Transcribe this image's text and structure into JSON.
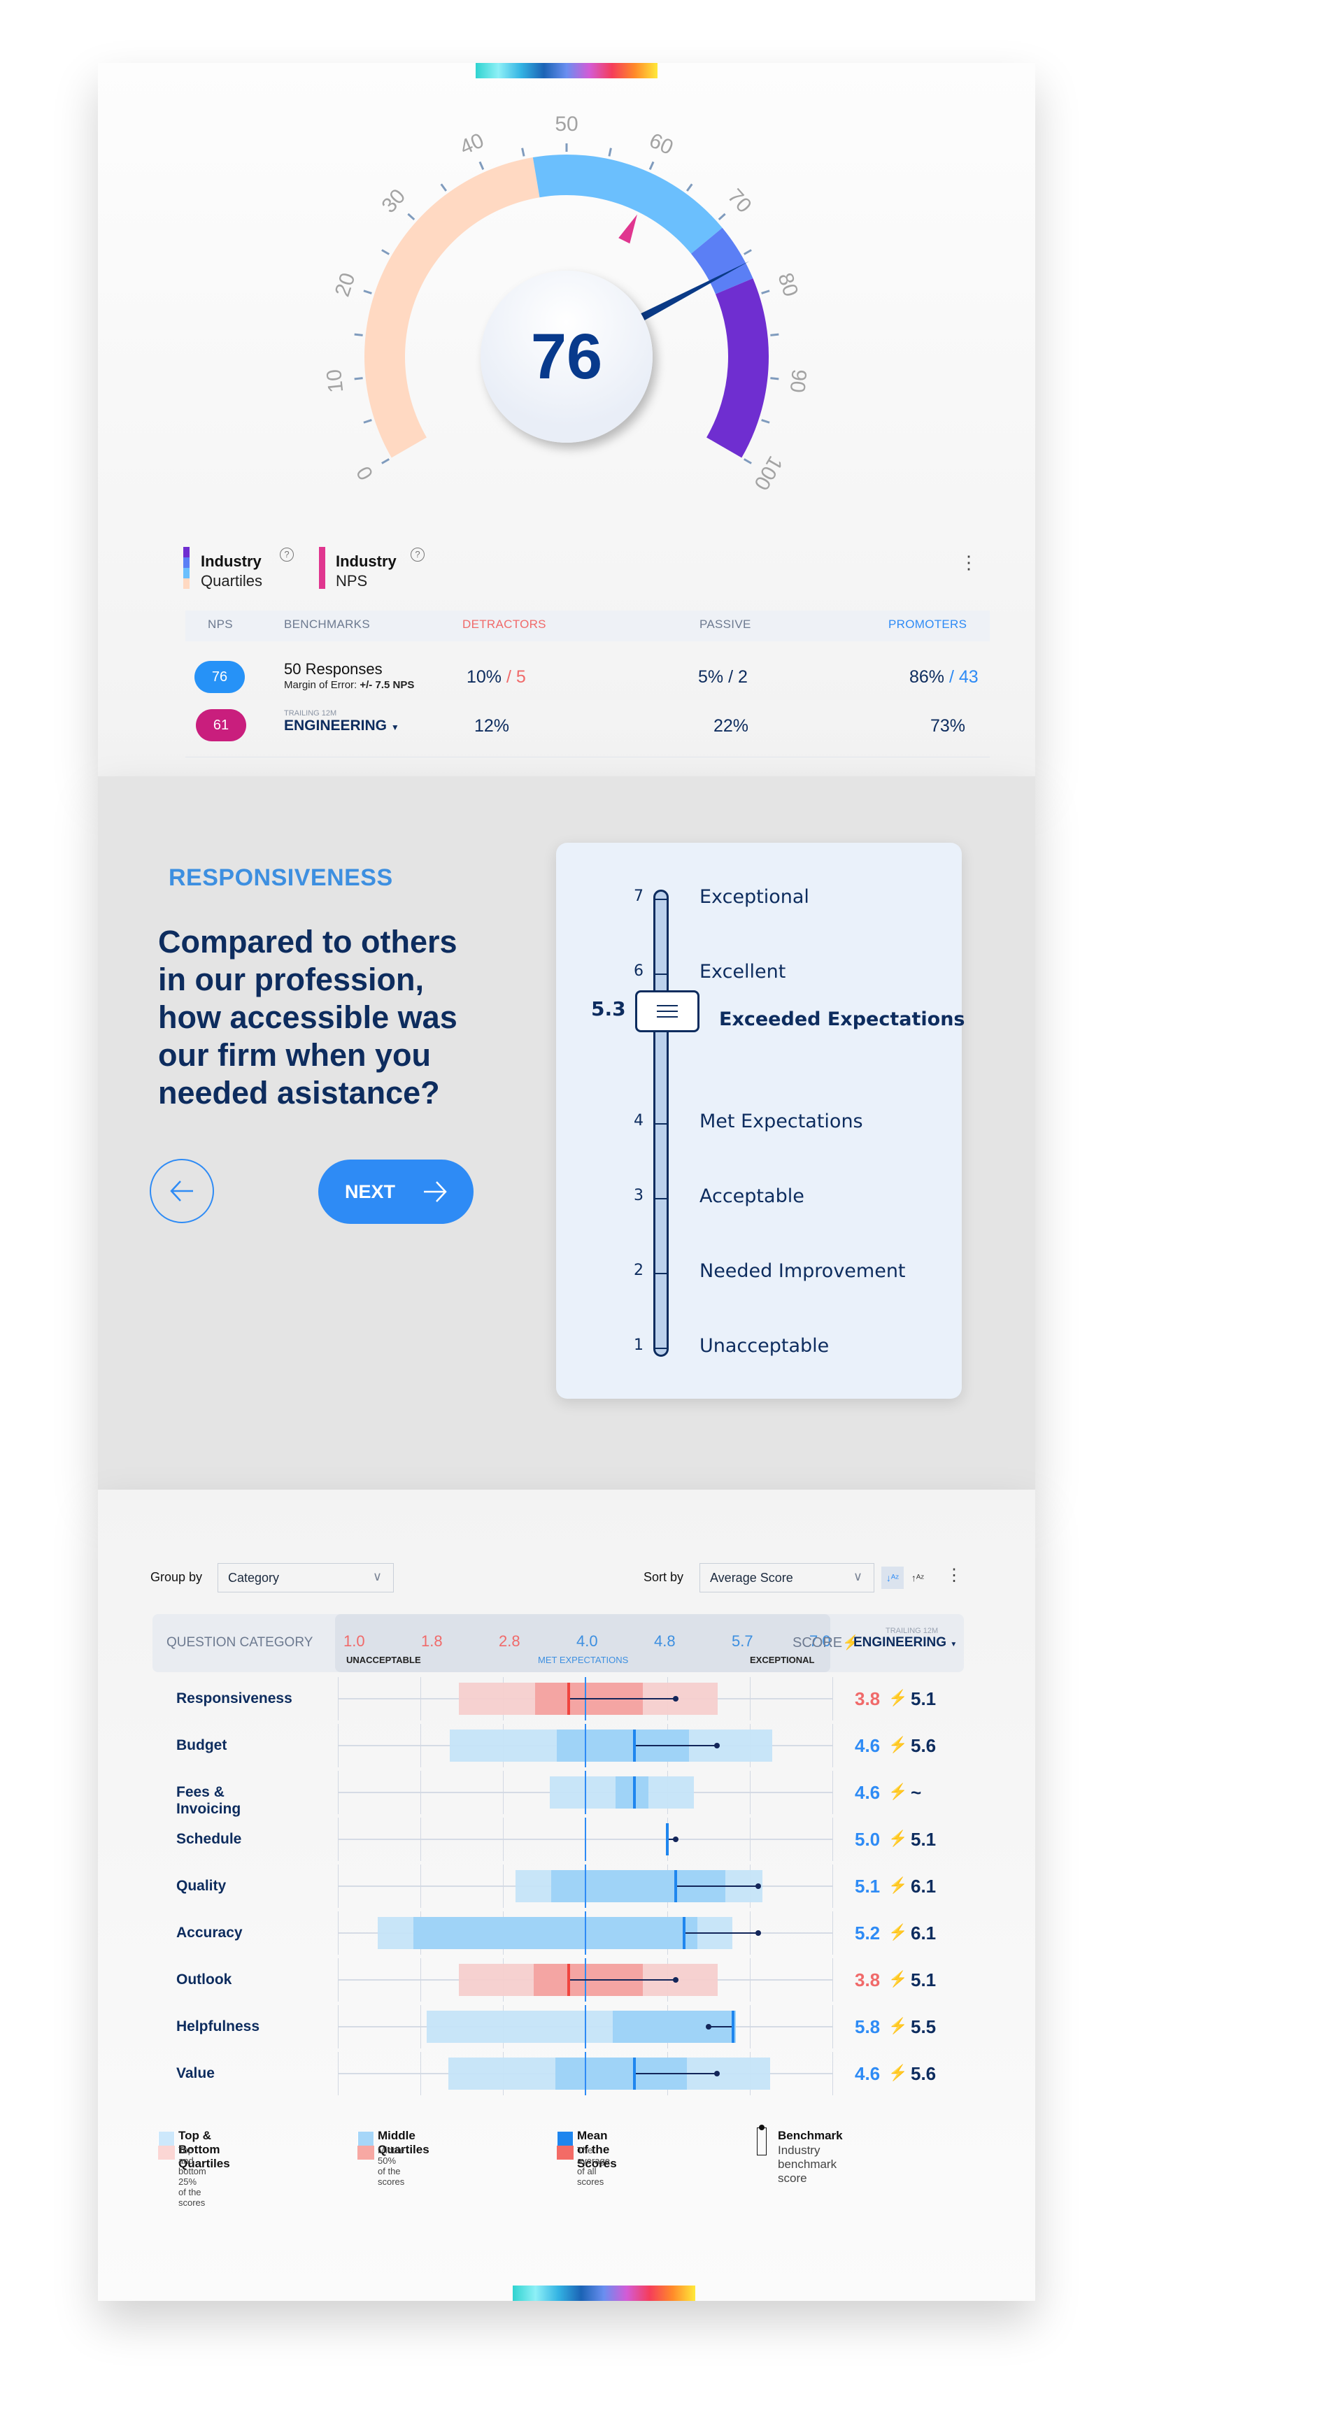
{
  "colors": {
    "navy": "#0d2c5e",
    "accent": "#2e8bf5",
    "detractor": "#f06a6a",
    "industry_nps": "#e0368f"
  },
  "gauge": {
    "value": "76",
    "needle_value": 76,
    "industry_nps_marker": 61,
    "min": 0,
    "max": 100,
    "tick_labels": [
      "0",
      "10",
      "20",
      "30",
      "40",
      "50",
      "60",
      "70",
      "80",
      "90",
      "100"
    ],
    "quartiles": [
      {
        "from": 0,
        "to": 46,
        "color": "#ffd9c2"
      },
      {
        "from": 46,
        "to": 71,
        "color": "#6bbffd"
      },
      {
        "from": 71,
        "to": 78,
        "color": "#5b7ff5"
      },
      {
        "from": 78,
        "to": 100,
        "color": "#6f2ed0"
      }
    ]
  },
  "legend": {
    "quartiles": {
      "line1": "Industry",
      "line2": "Quartiles",
      "help_icon": "question-circle-icon"
    },
    "nps": {
      "line1": "Industry",
      "line2": "NPS",
      "help_icon": "question-circle-icon"
    }
  },
  "nps_table": {
    "headers": {
      "nps": "NPS",
      "benchmarks": "BENCHMARKS",
      "detractors": "DETRACTORS",
      "passive": "PASSIVE",
      "promoters": "PROMOTERS"
    },
    "rows": [
      {
        "nps": "76",
        "badge_color": "#2692f7",
        "title": "50 Responses",
        "subtitle": "Margin of Error: ",
        "subtitle_bold": "+/- 7.5 NPS",
        "detractors": "10%",
        "detractors_count": "5",
        "passive": "5%",
        "passive_count": "2",
        "promoters": "86%",
        "promoters_count": "43"
      },
      {
        "nps": "61",
        "badge_color": "#c91e7d",
        "pre_label": "TRAILING 12M",
        "title": "ENGINEERING",
        "detractors": "12%",
        "passive": "22%",
        "promoters": "73%"
      }
    ]
  },
  "question": {
    "category": "RESPONSIVENESS",
    "lines": [
      "Compared to others",
      "in our profession,",
      "how accessible was",
      "our firm when you",
      "needed asistance?"
    ],
    "next_label": "NEXT",
    "slider": {
      "value": "5.3",
      "value_num": 5.3,
      "selected_label": "Exceeded Expectations",
      "levels": [
        {
          "n": "7",
          "label": "Exceptional"
        },
        {
          "n": "6",
          "label": "Excellent"
        },
        {
          "n": "4",
          "label": "Met Expectations"
        },
        {
          "n": "3",
          "label": "Acceptable"
        },
        {
          "n": "2",
          "label": "Needed Improvement"
        },
        {
          "n": "1",
          "label": "Unacceptable"
        }
      ]
    }
  },
  "controls": {
    "group_by_label": "Group by",
    "group_by_value": "Category",
    "sort_by_label": "Sort by",
    "sort_by_value": "Average Score"
  },
  "chart_data": {
    "type": "box",
    "header": {
      "category": "QUESTION CATEGORY",
      "score": "SCORE",
      "benchmark_pre": "TRAILING 12M",
      "benchmark": "ENGINEERING"
    },
    "ticks": [
      {
        "v": "1.0",
        "c": "#f06a6a"
      },
      {
        "v": "1.8",
        "c": "#f06a6a"
      },
      {
        "v": "2.8",
        "c": "#f06a6a"
      },
      {
        "v": "4.0",
        "c": "#3d8fe0"
      },
      {
        "v": "4.8",
        "c": "#3d8fe0"
      },
      {
        "v": "5.7",
        "c": "#3d8fe0"
      },
      {
        "v": "7.0",
        "c": "#3d8fe0"
      }
    ],
    "zone_labels": {
      "low": "UNACCEPTABLE",
      "mid": "MET EXPECTATIONS",
      "high": "EXCEPTIONAL"
    },
    "xlim": [
      1,
      7
    ],
    "rows": [
      {
        "label": "Responsiveness",
        "score": "3.8",
        "mean": 3.8,
        "benchmark": "5.1",
        "bench": 5.1,
        "low": true,
        "outer": [
          2.47,
          5.61
        ],
        "middle": [
          3.39,
          4.7
        ]
      },
      {
        "label": "Budget",
        "score": "4.6",
        "mean": 4.6,
        "benchmark": "5.6",
        "bench": 5.6,
        "low": false,
        "outer": [
          2.36,
          6.27
        ],
        "middle": [
          3.66,
          5.26
        ]
      },
      {
        "label": "Fees & Invoicing",
        "score": "4.6",
        "mean": 4.6,
        "benchmark": "~",
        "bench": null,
        "low": false,
        "outer": [
          3.57,
          5.32
        ],
        "middle": [
          4.37,
          4.77
        ]
      },
      {
        "label": "Schedule",
        "score": "5.0",
        "mean": 5.0,
        "benchmark": "5.1",
        "bench": 5.1,
        "low": false,
        "outer": null,
        "middle": null
      },
      {
        "label": "Quality",
        "score": "5.1",
        "mean": 5.1,
        "benchmark": "6.1",
        "bench": 6.1,
        "low": false,
        "outer": [
          3.16,
          6.15
        ],
        "middle": [
          3.59,
          5.7
        ]
      },
      {
        "label": "Accuracy",
        "score": "5.2",
        "mean": 5.2,
        "benchmark": "6.1",
        "bench": 6.1,
        "low": false,
        "outer": [
          1.48,
          5.79
        ],
        "middle": [
          1.92,
          5.36
        ]
      },
      {
        "label": "Outlook",
        "score": "3.8",
        "mean": 3.8,
        "benchmark": "5.1",
        "bench": 5.1,
        "low": true,
        "outer": [
          2.47,
          5.61
        ],
        "middle": [
          3.38,
          4.7
        ]
      },
      {
        "label": "Helpfulness",
        "score": "5.8",
        "mean": 5.8,
        "benchmark": "5.5",
        "bench": 5.5,
        "low": false,
        "outer": [
          2.08,
          5.83
        ],
        "middle": [
          4.34,
          5.83
        ]
      },
      {
        "label": "Value",
        "score": "4.6",
        "mean": 4.6,
        "benchmark": "5.6",
        "bench": 5.6,
        "low": false,
        "outer": [
          2.34,
          6.25
        ],
        "middle": [
          3.64,
          5.24
        ]
      }
    ],
    "legend": [
      {
        "title": "Top & Bottom Quartiles",
        "sub": "Top and bottom 25% of the scores"
      },
      {
        "title": "Middle Quartiles",
        "sub": "Middle 50% of the scores"
      },
      {
        "title": "Mean of the Scores",
        "sub": "The average of all scores"
      },
      {
        "title": "Benchmark",
        "sub": "Industry benchmark score"
      }
    ]
  }
}
